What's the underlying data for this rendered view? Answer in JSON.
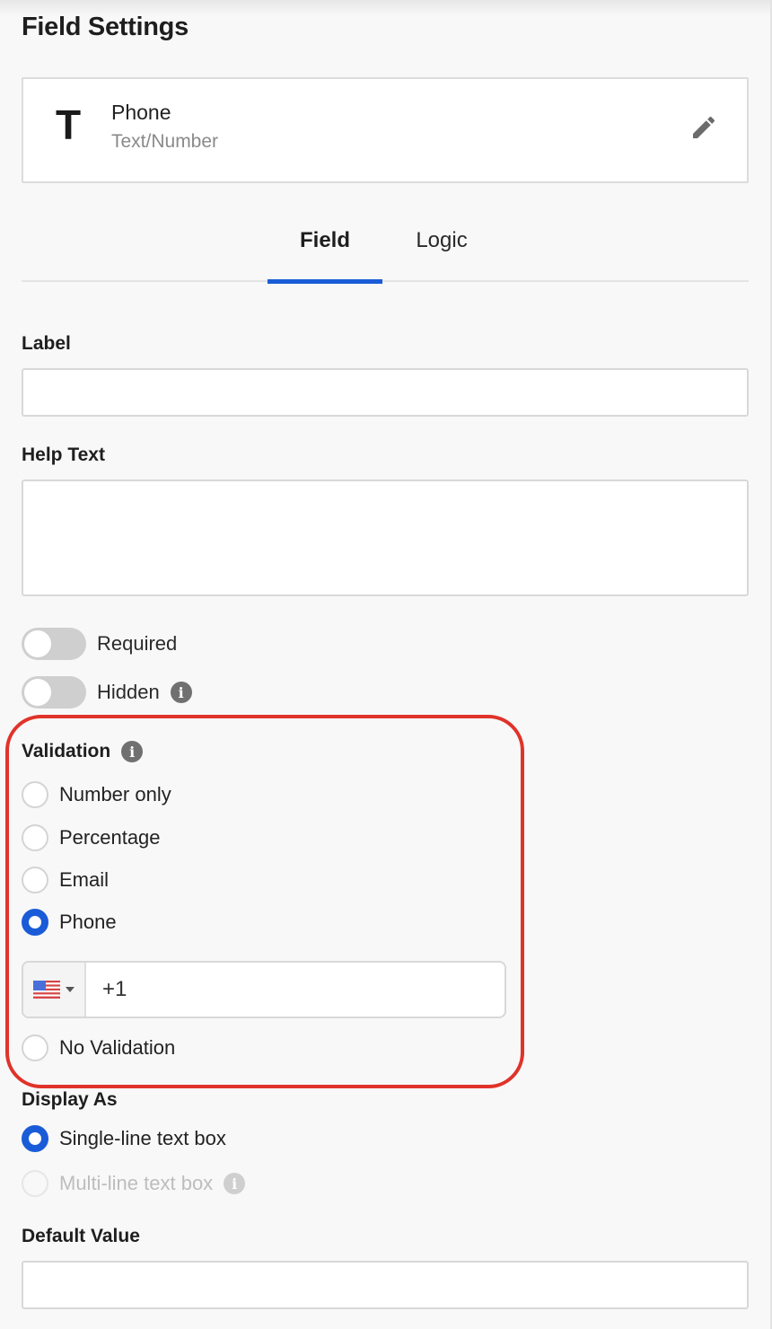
{
  "header": {
    "title": "Field Settings"
  },
  "field_card": {
    "type_icon_glyph": "T",
    "type_icon": "text-type-icon",
    "name": "Phone",
    "type": "Text/Number",
    "edit_icon": "pencil-icon"
  },
  "tabs": [
    {
      "label": "Field",
      "active": true
    },
    {
      "label": "Logic",
      "active": false
    }
  ],
  "form": {
    "label": {
      "title": "Label",
      "value": "",
      "placeholder": ""
    },
    "help_text": {
      "title": "Help Text",
      "value": "",
      "placeholder": ""
    },
    "toggles": [
      {
        "label": "Required",
        "on": false,
        "info": false
      },
      {
        "label": "Hidden",
        "on": false,
        "info": true
      }
    ],
    "validation": {
      "title": "Validation",
      "info_icon": "info-icon",
      "options": [
        {
          "label": "Number only",
          "checked": false
        },
        {
          "label": "Percentage",
          "checked": false
        },
        {
          "label": "Email",
          "checked": false
        },
        {
          "label": "Phone",
          "checked": true
        },
        {
          "label": "No Validation",
          "checked": false
        }
      ],
      "phone": {
        "country_flag": "us-flag-icon",
        "country": "US",
        "value": "+1"
      }
    },
    "display_as": {
      "title": "Display As",
      "options": [
        {
          "label": "Single-line text box",
          "checked": true,
          "disabled": false
        },
        {
          "label": "Multi-line text box",
          "checked": false,
          "disabled": true,
          "info": true
        }
      ]
    },
    "default_value": {
      "title": "Default Value",
      "value": "",
      "placeholder": ""
    }
  },
  "colors": {
    "accent": "#1a5cd8",
    "highlight": "#e0332a",
    "background": "#f8f8f8"
  },
  "info_glyph": "i"
}
